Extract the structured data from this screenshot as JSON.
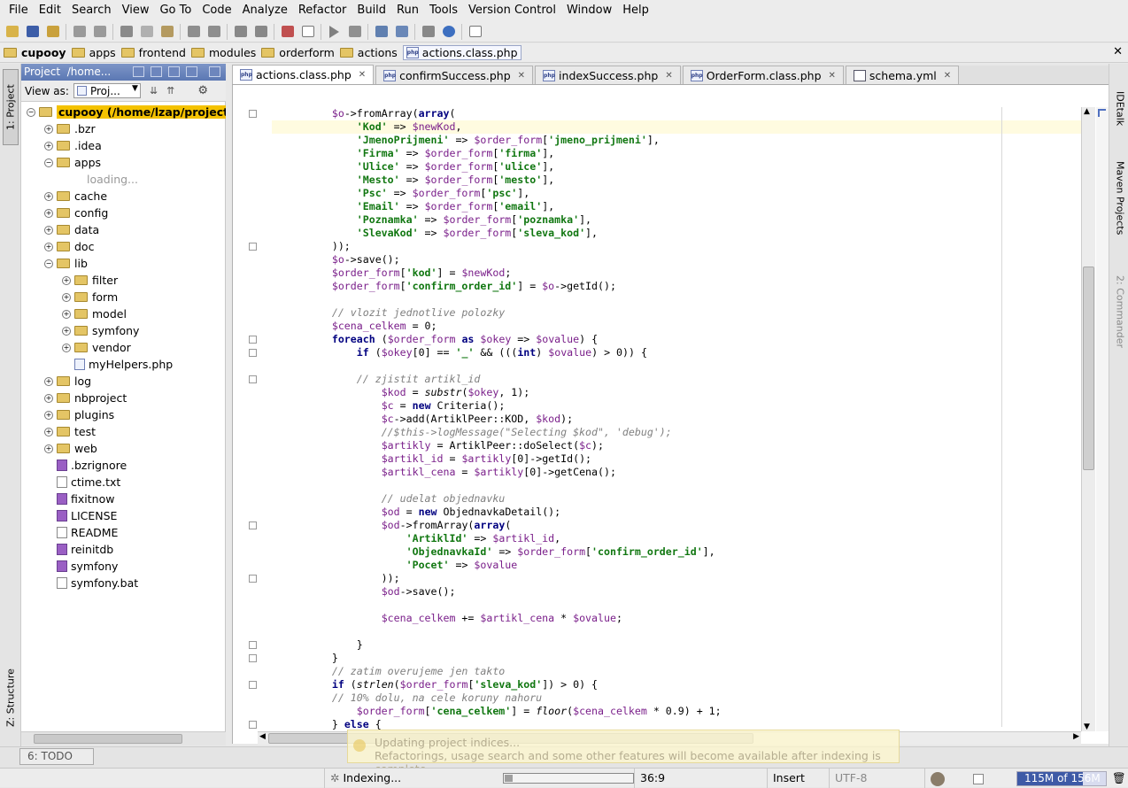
{
  "menu": [
    "File",
    "Edit",
    "Search",
    "View",
    "Go To",
    "Code",
    "Analyze",
    "Refactor",
    "Build",
    "Run",
    "Tools",
    "Version Control",
    "Window",
    "Help"
  ],
  "toolbar_icons": [
    "open-icon",
    "save-icon",
    "sync-icon",
    "undo-icon",
    "redo-icon",
    "cut-icon",
    "copy-icon",
    "paste-icon",
    "find-icon",
    "replace-icon",
    "back-icon",
    "forward-icon",
    "structure-icon",
    "dropdown-icon",
    "run-icon",
    "debug-icon",
    "settings-icon",
    "plugins-icon",
    "tasks-icon",
    "help-icon",
    "more-icon"
  ],
  "breadcrumbs": [
    "cupooy",
    "apps",
    "frontend",
    "modules",
    "orderform",
    "actions",
    "actions.class.php"
  ],
  "left_tabs": {
    "project": "1: Project",
    "structure": "Z: Structure"
  },
  "right_tabs": {
    "idetalk": "IDEtalk",
    "maven": "Maven Projects",
    "commander": "2: Commander"
  },
  "project_panel": {
    "title": "Project",
    "path": "/home...",
    "view_as_label": "View as:",
    "view_as_value": "Proj..."
  },
  "tree": [
    {
      "label": "cupooy (/home/lzap/projects",
      "depth": 0,
      "type": "folder",
      "toggle": "-",
      "selected": true
    },
    {
      "label": ".bzr",
      "depth": 1,
      "type": "folder",
      "toggle": "+"
    },
    {
      "label": ".idea",
      "depth": 1,
      "type": "folder",
      "toggle": "+"
    },
    {
      "label": "apps",
      "depth": 1,
      "type": "folder",
      "toggle": "-"
    },
    {
      "label": "loading...",
      "depth": 2,
      "type": "loading",
      "toggle": ""
    },
    {
      "label": "cache",
      "depth": 1,
      "type": "folder",
      "toggle": "+"
    },
    {
      "label": "config",
      "depth": 1,
      "type": "folder",
      "toggle": "+"
    },
    {
      "label": "data",
      "depth": 1,
      "type": "folder",
      "toggle": "+"
    },
    {
      "label": "doc",
      "depth": 1,
      "type": "folder",
      "toggle": "+"
    },
    {
      "label": "lib",
      "depth": 1,
      "type": "folder",
      "toggle": "-"
    },
    {
      "label": "filter",
      "depth": 2,
      "type": "folder",
      "toggle": "+"
    },
    {
      "label": "form",
      "depth": 2,
      "type": "folder",
      "toggle": "+"
    },
    {
      "label": "model",
      "depth": 2,
      "type": "folder",
      "toggle": "+"
    },
    {
      "label": "symfony",
      "depth": 2,
      "type": "folder",
      "toggle": "+"
    },
    {
      "label": "vendor",
      "depth": 2,
      "type": "folder",
      "toggle": "+"
    },
    {
      "label": "myHelpers.php",
      "depth": 2,
      "type": "php",
      "toggle": ""
    },
    {
      "label": "log",
      "depth": 1,
      "type": "folder",
      "toggle": "+"
    },
    {
      "label": "nbproject",
      "depth": 1,
      "type": "folder",
      "toggle": "+"
    },
    {
      "label": "plugins",
      "depth": 1,
      "type": "folder",
      "toggle": "+"
    },
    {
      "label": "test",
      "depth": 1,
      "type": "folder",
      "toggle": "+"
    },
    {
      "label": "web",
      "depth": 1,
      "type": "folder",
      "toggle": "+"
    },
    {
      "label": ".bzrignore",
      "depth": 1,
      "type": "unknown",
      "toggle": ""
    },
    {
      "label": "ctime.txt",
      "depth": 1,
      "type": "text",
      "toggle": ""
    },
    {
      "label": "fixitnow",
      "depth": 1,
      "type": "unknown",
      "toggle": ""
    },
    {
      "label": "LICENSE",
      "depth": 1,
      "type": "unknown",
      "toggle": ""
    },
    {
      "label": "README",
      "depth": 1,
      "type": "text",
      "toggle": ""
    },
    {
      "label": "reinitdb",
      "depth": 1,
      "type": "unknown",
      "toggle": ""
    },
    {
      "label": "symfony",
      "depth": 1,
      "type": "unknown",
      "toggle": ""
    },
    {
      "label": "symfony.bat",
      "depth": 1,
      "type": "text",
      "toggle": ""
    }
  ],
  "tabs": [
    {
      "label": "actions.class.php",
      "active": true,
      "icon": "php"
    },
    {
      "label": "confirmSuccess.php",
      "active": false,
      "icon": "php"
    },
    {
      "label": "indexSuccess.php",
      "active": false,
      "icon": "php"
    },
    {
      "label": "OrderForm.class.php",
      "active": false,
      "icon": "php"
    },
    {
      "label": "schema.yml",
      "active": false,
      "icon": "yml"
    }
  ],
  "code_lines": [
    [
      [
        "t",
        "        "
      ],
      [
        "v",
        "$o"
      ],
      [
        "t",
        "->fromArray("
      ],
      [
        "k",
        "array"
      ],
      [
        "t",
        "("
      ]
    ],
    [
      [
        "t",
        "            "
      ],
      [
        "s",
        "'Kod'"
      ],
      [
        "t",
        " => "
      ],
      [
        "v",
        "$newKod"
      ],
      [
        "t",
        ","
      ]
    ],
    [
      [
        "t",
        "            "
      ],
      [
        "s",
        "'JmenoPrijmeni'"
      ],
      [
        "t",
        " => "
      ],
      [
        "v",
        "$order_form"
      ],
      [
        "t",
        "["
      ],
      [
        "s",
        "'jmeno_prijmeni'"
      ],
      [
        "t",
        "],"
      ]
    ],
    [
      [
        "t",
        "            "
      ],
      [
        "s",
        "'Firma'"
      ],
      [
        "t",
        " => "
      ],
      [
        "v",
        "$order_form"
      ],
      [
        "t",
        "["
      ],
      [
        "s",
        "'firma'"
      ],
      [
        "t",
        "],"
      ]
    ],
    [
      [
        "t",
        "            "
      ],
      [
        "s",
        "'Ulice'"
      ],
      [
        "t",
        " => "
      ],
      [
        "v",
        "$order_form"
      ],
      [
        "t",
        "["
      ],
      [
        "s",
        "'ulice'"
      ],
      [
        "t",
        "],"
      ]
    ],
    [
      [
        "t",
        "            "
      ],
      [
        "s",
        "'Mesto'"
      ],
      [
        "t",
        " => "
      ],
      [
        "v",
        "$order_form"
      ],
      [
        "t",
        "["
      ],
      [
        "s",
        "'mesto'"
      ],
      [
        "t",
        "],"
      ]
    ],
    [
      [
        "t",
        "            "
      ],
      [
        "s",
        "'Psc'"
      ],
      [
        "t",
        " => "
      ],
      [
        "v",
        "$order_form"
      ],
      [
        "t",
        "["
      ],
      [
        "s",
        "'psc'"
      ],
      [
        "t",
        "],"
      ]
    ],
    [
      [
        "t",
        "            "
      ],
      [
        "s",
        "'Email'"
      ],
      [
        "t",
        " => "
      ],
      [
        "v",
        "$order_form"
      ],
      [
        "t",
        "["
      ],
      [
        "s",
        "'email'"
      ],
      [
        "t",
        "],"
      ]
    ],
    [
      [
        "t",
        "            "
      ],
      [
        "s",
        "'Poznamka'"
      ],
      [
        "t",
        " => "
      ],
      [
        "v",
        "$order_form"
      ],
      [
        "t",
        "["
      ],
      [
        "s",
        "'poznamka'"
      ],
      [
        "t",
        "],"
      ]
    ],
    [
      [
        "t",
        "            "
      ],
      [
        "s",
        "'SlevaKod'"
      ],
      [
        "t",
        " => "
      ],
      [
        "v",
        "$order_form"
      ],
      [
        "t",
        "["
      ],
      [
        "s",
        "'sleva_kod'"
      ],
      [
        "t",
        "],"
      ]
    ],
    [
      [
        "t",
        "        ));"
      ]
    ],
    [
      [
        "t",
        "        "
      ],
      [
        "v",
        "$o"
      ],
      [
        "t",
        "->save();"
      ]
    ],
    [
      [
        "t",
        "        "
      ],
      [
        "v",
        "$order_form"
      ],
      [
        "t",
        "["
      ],
      [
        "s",
        "'kod'"
      ],
      [
        "t",
        "] = "
      ],
      [
        "v",
        "$newKod"
      ],
      [
        "t",
        ";"
      ]
    ],
    [
      [
        "t",
        "        "
      ],
      [
        "v",
        "$order_form"
      ],
      [
        "t",
        "["
      ],
      [
        "s",
        "'confirm_order_id'"
      ],
      [
        "t",
        "] = "
      ],
      [
        "v",
        "$o"
      ],
      [
        "t",
        "->getId();"
      ]
    ],
    [
      [
        "t",
        ""
      ]
    ],
    [
      [
        "t",
        "        "
      ],
      [
        "c",
        "// vlozit jednotlive polozky"
      ]
    ],
    [
      [
        "t",
        "        "
      ],
      [
        "v",
        "$cena_celkem"
      ],
      [
        "t",
        " = 0;"
      ]
    ],
    [
      [
        "t",
        "        "
      ],
      [
        "k",
        "foreach"
      ],
      [
        "t",
        " ("
      ],
      [
        "v",
        "$order_form"
      ],
      [
        "t",
        " "
      ],
      [
        "k",
        "as"
      ],
      [
        "t",
        " "
      ],
      [
        "v",
        "$okey"
      ],
      [
        "t",
        " => "
      ],
      [
        "v",
        "$ovalue"
      ],
      [
        "t",
        ") {"
      ]
    ],
    [
      [
        "t",
        "            "
      ],
      [
        "k",
        "if"
      ],
      [
        "t",
        " ("
      ],
      [
        "v",
        "$okey"
      ],
      [
        "t",
        "[0] == "
      ],
      [
        "s",
        "'_'"
      ],
      [
        "t",
        " && ((("
      ],
      [
        "k",
        "int"
      ],
      [
        "t",
        ") "
      ],
      [
        "v",
        "$ovalue"
      ],
      [
        "t",
        ") > 0)) {"
      ]
    ],
    [
      [
        "t",
        ""
      ]
    ],
    [
      [
        "t",
        "            "
      ],
      [
        "c",
        "// zjistit artikl_id"
      ]
    ],
    [
      [
        "t",
        "                "
      ],
      [
        "v",
        "$kod"
      ],
      [
        "t",
        " = "
      ],
      [
        "f",
        "substr"
      ],
      [
        "t",
        "("
      ],
      [
        "v",
        "$okey"
      ],
      [
        "t",
        ", 1);"
      ]
    ],
    [
      [
        "t",
        "                "
      ],
      [
        "v",
        "$c"
      ],
      [
        "t",
        " = "
      ],
      [
        "k",
        "new"
      ],
      [
        "t",
        " Criteria();"
      ]
    ],
    [
      [
        "t",
        "                "
      ],
      [
        "v",
        "$c"
      ],
      [
        "t",
        "->add(ArtiklPeer::KOD, "
      ],
      [
        "v",
        "$kod"
      ],
      [
        "t",
        ");"
      ]
    ],
    [
      [
        "t",
        "                "
      ],
      [
        "c",
        "//$this->logMessage(\"Selecting $kod\", 'debug');"
      ]
    ],
    [
      [
        "t",
        "                "
      ],
      [
        "v",
        "$artikly"
      ],
      [
        "t",
        " = ArtiklPeer::doSelect("
      ],
      [
        "v",
        "$c"
      ],
      [
        "t",
        ");"
      ]
    ],
    [
      [
        "t",
        "                "
      ],
      [
        "v",
        "$artikl_id"
      ],
      [
        "t",
        " = "
      ],
      [
        "v",
        "$artikly"
      ],
      [
        "t",
        "[0]->getId();"
      ]
    ],
    [
      [
        "t",
        "                "
      ],
      [
        "v",
        "$artikl_cena"
      ],
      [
        "t",
        " = "
      ],
      [
        "v",
        "$artikly"
      ],
      [
        "t",
        "[0]->getCena();"
      ]
    ],
    [
      [
        "t",
        ""
      ]
    ],
    [
      [
        "t",
        "                "
      ],
      [
        "c",
        "// udelat objednavku"
      ]
    ],
    [
      [
        "t",
        "                "
      ],
      [
        "v",
        "$od"
      ],
      [
        "t",
        " = "
      ],
      [
        "k",
        "new"
      ],
      [
        "t",
        " ObjednavkaDetail();"
      ]
    ],
    [
      [
        "t",
        "                "
      ],
      [
        "v",
        "$od"
      ],
      [
        "t",
        "->fromArray("
      ],
      [
        "k",
        "array"
      ],
      [
        "t",
        "("
      ]
    ],
    [
      [
        "t",
        "                    "
      ],
      [
        "s",
        "'ArtiklId'"
      ],
      [
        "t",
        " => "
      ],
      [
        "v",
        "$artikl_id"
      ],
      [
        "t",
        ","
      ]
    ],
    [
      [
        "t",
        "                    "
      ],
      [
        "s",
        "'ObjednavkaId'"
      ],
      [
        "t",
        " => "
      ],
      [
        "v",
        "$order_form"
      ],
      [
        "t",
        "["
      ],
      [
        "s",
        "'confirm_order_id'"
      ],
      [
        "t",
        "],"
      ]
    ],
    [
      [
        "t",
        "                    "
      ],
      [
        "s",
        "'Pocet'"
      ],
      [
        "t",
        " => "
      ],
      [
        "v",
        "$ovalue"
      ]
    ],
    [
      [
        "t",
        "                ));"
      ]
    ],
    [
      [
        "t",
        "                "
      ],
      [
        "v",
        "$od"
      ],
      [
        "t",
        "->save();"
      ]
    ],
    [
      [
        "t",
        ""
      ]
    ],
    [
      [
        "t",
        "                "
      ],
      [
        "v",
        "$cena_celkem"
      ],
      [
        "t",
        " += "
      ],
      [
        "v",
        "$artikl_cena"
      ],
      [
        "t",
        " * "
      ],
      [
        "v",
        "$ovalue"
      ],
      [
        "t",
        ";"
      ]
    ],
    [
      [
        "t",
        ""
      ]
    ],
    [
      [
        "t",
        "            }"
      ]
    ],
    [
      [
        "t",
        "        }"
      ]
    ],
    [
      [
        "t",
        "        "
      ],
      [
        "c",
        "// zatim overujeme jen takto"
      ]
    ],
    [
      [
        "t",
        "        "
      ],
      [
        "k",
        "if"
      ],
      [
        "t",
        " ("
      ],
      [
        "f",
        "strlen"
      ],
      [
        "t",
        "("
      ],
      [
        "v",
        "$order_form"
      ],
      [
        "t",
        "["
      ],
      [
        "s",
        "'sleva_kod'"
      ],
      [
        "t",
        "]) > 0) {"
      ]
    ],
    [
      [
        "t",
        "        "
      ],
      [
        "c",
        "// 10% dolu, na cele koruny nahoru"
      ]
    ],
    [
      [
        "t",
        "            "
      ],
      [
        "v",
        "$order_form"
      ],
      [
        "t",
        "["
      ],
      [
        "s",
        "'cena_celkem'"
      ],
      [
        "t",
        "] = "
      ],
      [
        "f",
        "floor"
      ],
      [
        "t",
        "("
      ],
      [
        "v",
        "$cena_celkem"
      ],
      [
        "t",
        " * 0.9) + 1;"
      ]
    ],
    [
      [
        "t",
        "        } "
      ],
      [
        "k",
        "else"
      ],
      [
        "t",
        " {"
      ]
    ]
  ],
  "popup": {
    "title": "Updating project indices...",
    "message": "Refactorings, usage search and some other features will become available after indexing is complete"
  },
  "todo_label": "6: TODO",
  "status": {
    "indexing": "Indexing...",
    "progress": 0.06,
    "position": "36:9",
    "mode": "Insert",
    "encoding": "UTF-8",
    "memory": "115M of 156M",
    "memory_used_fraction": 0.74
  }
}
